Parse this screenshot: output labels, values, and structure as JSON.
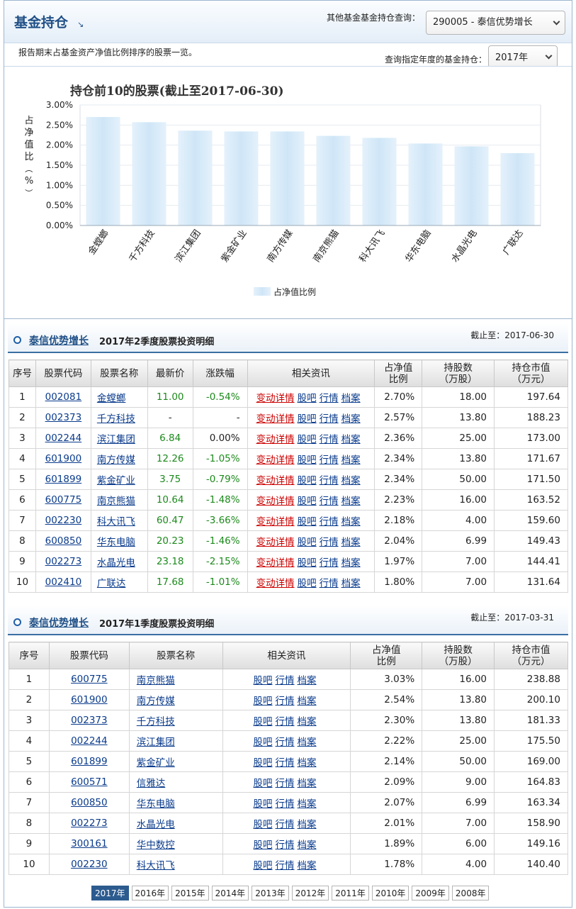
{
  "header": {
    "title": "基金持仓",
    "other_label": "其他基金基金持仓查询：",
    "fund_select": "290005 - 泰信优势增长",
    "desc": "报告期末占基金资产净值比例排序的股票一览。",
    "year_label": "查询指定年度的基金持仓：",
    "year_select": "2017年"
  },
  "chart_data": {
    "type": "bar",
    "title": "持仓前10的股票(截止至2017-06-30)",
    "ylabel": "占净值比（%）",
    "categories": [
      "金螳螂",
      "千方科技",
      "滨江集团",
      "紫金矿业",
      "南方传媒",
      "南京熊猫",
      "科大讯飞",
      "华东电脑",
      "水晶光电",
      "广联达"
    ],
    "series": [
      {
        "name": "占净值比例",
        "values": [
          2.7,
          2.57,
          2.36,
          2.34,
          2.34,
          2.23,
          2.18,
          2.04,
          1.97,
          1.8
        ]
      }
    ],
    "yticks": [
      "3.00%",
      "2.50%",
      "2.00%",
      "1.50%",
      "1.00%",
      "0.50%",
      "0.00%"
    ],
    "ylim": [
      0,
      3
    ],
    "grid": true,
    "legend": "bottom-center",
    "bar_color": "#cfe6f7"
  },
  "q2": {
    "fund": "泰信优势增长",
    "title": "2017年2季度股票投资明细",
    "date": "截止至：2017-06-30",
    "headers": [
      "序号",
      "股票代码",
      "股票名称",
      "最新价",
      "涨跌幅",
      "相关资讯",
      "占净值\n比例",
      "持股数\n（万股）",
      "持仓市值\n（万元）"
    ],
    "links": [
      "变动详情",
      "股吧",
      "行情",
      "档案"
    ],
    "rows": [
      {
        "no": "1",
        "code": "002081",
        "name": "金螳螂",
        "price": "11.00",
        "chg": "-0.54%",
        "ratio": "2.70%",
        "shares": "18.00",
        "value": "197.64"
      },
      {
        "no": "2",
        "code": "002373",
        "name": "千方科技",
        "price": "-",
        "chg": "-",
        "ratio": "2.57%",
        "shares": "13.80",
        "value": "188.23"
      },
      {
        "no": "3",
        "code": "002244",
        "name": "滨江集团",
        "price": "6.84",
        "chg": "0.00%",
        "ratio": "2.36%",
        "shares": "25.00",
        "value": "173.00"
      },
      {
        "no": "4",
        "code": "601900",
        "name": "南方传媒",
        "price": "12.26",
        "chg": "-1.05%",
        "ratio": "2.34%",
        "shares": "13.80",
        "value": "171.67"
      },
      {
        "no": "5",
        "code": "601899",
        "name": "紫金矿业",
        "price": "3.75",
        "chg": "-0.79%",
        "ratio": "2.34%",
        "shares": "50.00",
        "value": "171.50"
      },
      {
        "no": "6",
        "code": "600775",
        "name": "南京熊猫",
        "price": "10.64",
        "chg": "-1.48%",
        "ratio": "2.23%",
        "shares": "16.00",
        "value": "163.52"
      },
      {
        "no": "7",
        "code": "002230",
        "name": "科大讯飞",
        "price": "60.47",
        "chg": "-3.66%",
        "ratio": "2.18%",
        "shares": "4.00",
        "value": "159.60"
      },
      {
        "no": "8",
        "code": "600850",
        "name": "华东电脑",
        "price": "20.23",
        "chg": "-1.46%",
        "ratio": "2.04%",
        "shares": "6.99",
        "value": "149.43"
      },
      {
        "no": "9",
        "code": "002273",
        "name": "水晶光电",
        "price": "23.18",
        "chg": "-2.15%",
        "ratio": "1.97%",
        "shares": "7.00",
        "value": "144.41"
      },
      {
        "no": "10",
        "code": "002410",
        "name": "广联达",
        "price": "17.68",
        "chg": "-1.01%",
        "ratio": "1.80%",
        "shares": "7.00",
        "value": "131.64"
      }
    ]
  },
  "q1": {
    "fund": "泰信优势增长",
    "title": "2017年1季度股票投资明细",
    "date": "截止至：2017-03-31",
    "headers": [
      "序号",
      "股票代码",
      "股票名称",
      "相关资讯",
      "占净值\n比例",
      "持股数\n（万股）",
      "持仓市值\n（万元）"
    ],
    "links": [
      "股吧",
      "行情",
      "档案"
    ],
    "rows": [
      {
        "no": "1",
        "code": "600775",
        "name": "南京熊猫",
        "ratio": "3.03%",
        "shares": "16.00",
        "value": "238.88"
      },
      {
        "no": "2",
        "code": "601900",
        "name": "南方传媒",
        "ratio": "2.54%",
        "shares": "13.80",
        "value": "200.10"
      },
      {
        "no": "3",
        "code": "002373",
        "name": "千方科技",
        "ratio": "2.30%",
        "shares": "13.80",
        "value": "181.33"
      },
      {
        "no": "4",
        "code": "002244",
        "name": "滨江集团",
        "ratio": "2.22%",
        "shares": "25.00",
        "value": "175.50"
      },
      {
        "no": "5",
        "code": "601899",
        "name": "紫金矿业",
        "ratio": "2.14%",
        "shares": "50.00",
        "value": "169.00"
      },
      {
        "no": "6",
        "code": "600571",
        "name": "信雅达",
        "ratio": "2.09%",
        "shares": "9.00",
        "value": "164.83"
      },
      {
        "no": "7",
        "code": "600850",
        "name": "华东电脑",
        "ratio": "2.07%",
        "shares": "6.99",
        "value": "163.34"
      },
      {
        "no": "8",
        "code": "002273",
        "name": "水晶光电",
        "ratio": "2.01%",
        "shares": "7.00",
        "value": "158.90"
      },
      {
        "no": "9",
        "code": "300161",
        "name": "华中数控",
        "ratio": "1.89%",
        "shares": "6.00",
        "value": "149.16"
      },
      {
        "no": "10",
        "code": "002230",
        "name": "科大讯飞",
        "ratio": "1.78%",
        "shares": "4.00",
        "value": "140.40"
      }
    ]
  },
  "years": {
    "items": [
      "2017年",
      "2016年",
      "2015年",
      "2014年",
      "2013年",
      "2012年",
      "2011年",
      "2010年",
      "2009年",
      "2008年"
    ],
    "active": "2017年"
  }
}
